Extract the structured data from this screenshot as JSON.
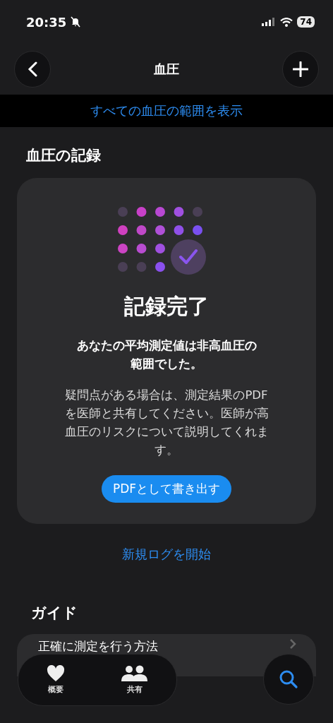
{
  "status_bar": {
    "time": "20:35",
    "battery": "74"
  },
  "nav": {
    "title": "血圧"
  },
  "banner": {
    "link": "すべての血圧の範囲を表示"
  },
  "record_section": {
    "heading": "血圧の記録",
    "card": {
      "title": "記録完了",
      "summary": "あなたの平均測定値は非高血圧の範囲でした。",
      "body": "疑問点がある場合は、測定結果のPDFを医師と共有してください。医師が高血圧のリスクについて説明してくれます。",
      "button": "PDFとして書き出す"
    },
    "link": "新規ログを開始"
  },
  "guide_section": {
    "heading": "ガイド",
    "items": [
      {
        "label": "正確に測定を行う方法"
      }
    ]
  },
  "tab_bar": {
    "tabs": [
      {
        "label": "概要",
        "kind": "heart"
      },
      {
        "label": "共有",
        "kind": "people"
      }
    ]
  }
}
